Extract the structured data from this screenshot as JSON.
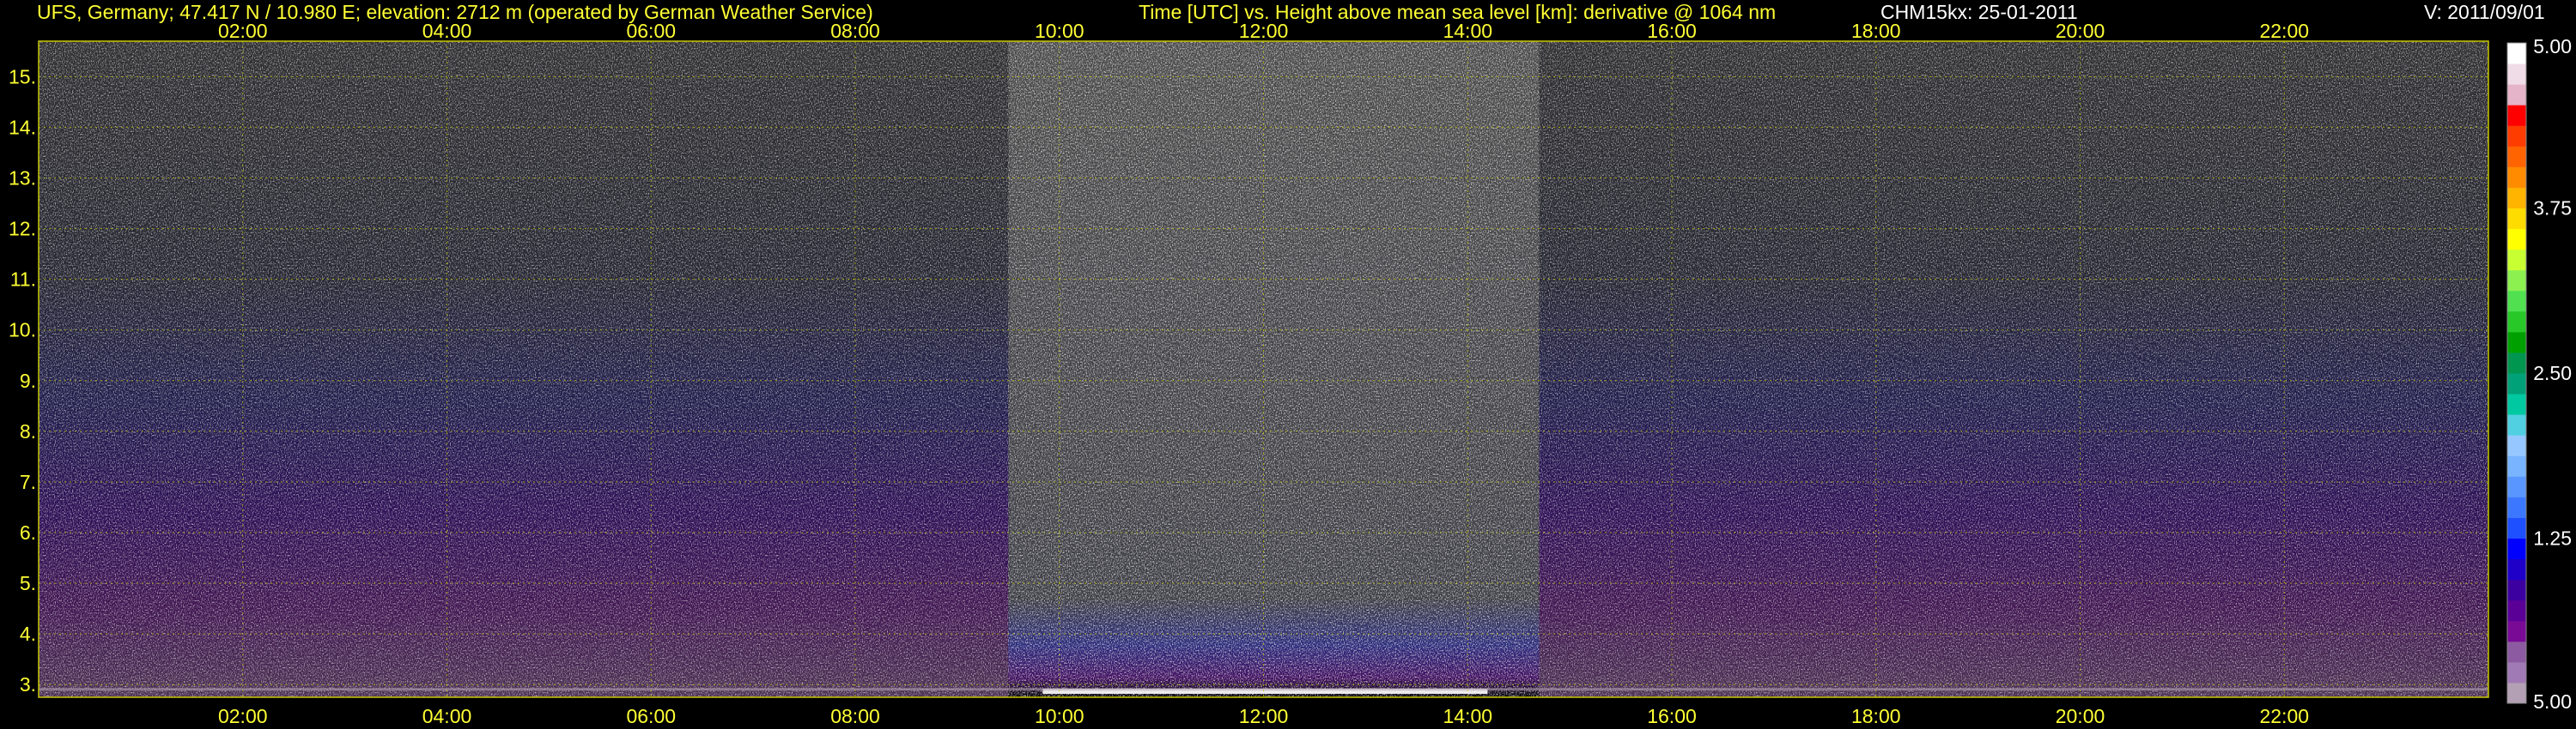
{
  "header": {
    "station": "UFS, Germany; 47.417 N / 10.980 E; elevation: 2712 m  (operated by German Weather Service)",
    "plot_title": "Time [UTC] vs. Height above mean sea level [km]: derivative @ 1064 nm",
    "instrument": "CHM15kx: 25-01-2011",
    "version": "V: 2011/09/01"
  },
  "colors": {
    "header_text": "#ffff33",
    "tick_text": "#ffff33",
    "header_white": "#ffffff",
    "grid": "#c8c800",
    "background": "#000000"
  },
  "chart_data": {
    "type": "heatmap",
    "title": "Time [UTC] vs. Height above mean sea level [km]: derivative @ 1064 nm",
    "xlabel": "Time [UTC]",
    "ylabel": "Height above mean sea level [km]",
    "x_ticks": [
      "02:00",
      "04:00",
      "06:00",
      "08:00",
      "10:00",
      "12:00",
      "14:00",
      "16:00",
      "18:00",
      "20:00",
      "22:00"
    ],
    "x_tick_hours": [
      2,
      4,
      6,
      8,
      10,
      12,
      14,
      16,
      18,
      20,
      22
    ],
    "xlim_hours": [
      0,
      24
    ],
    "y_ticks": [
      "3.",
      "4.",
      "5.",
      "6.",
      "7.",
      "8.",
      "9.",
      "10.",
      "11.",
      "12.",
      "13.",
      "14.",
      "15."
    ],
    "y_tick_values": [
      3,
      4,
      5,
      6,
      7,
      8,
      9,
      10,
      11,
      12,
      13,
      14,
      15
    ],
    "ylim": [
      2.75,
      15.7
    ],
    "grid": true,
    "colorbar": {
      "labels": [
        "5.00",
        "3.75",
        "2.50",
        "1.25",
        "5.00"
      ],
      "label_values": [
        5.0,
        3.75,
        2.5,
        1.25,
        0
      ],
      "colors": [
        "#b4a0b4",
        "#a07ab4",
        "#8c5aa0",
        "#780a96",
        "#5a0096",
        "#3c00a0",
        "#1e00c8",
        "#0000ff",
        "#1e50ff",
        "#3c78ff",
        "#5a96ff",
        "#78b4ff",
        "#96c8ff",
        "#50d0e0",
        "#00c8a0",
        "#00a078",
        "#009650",
        "#00a000",
        "#28c828",
        "#50e050",
        "#8cf050",
        "#c8ff32",
        "#ffff00",
        "#ffdc00",
        "#ffb400",
        "#ff8c00",
        "#ff6400",
        "#ff3c00",
        "#ff0000",
        "#e6b4c8",
        "#f0dce6",
        "#ffffff"
      ]
    },
    "bright_period_hours": [
      9.5,
      14.7
    ],
    "annotations": []
  }
}
